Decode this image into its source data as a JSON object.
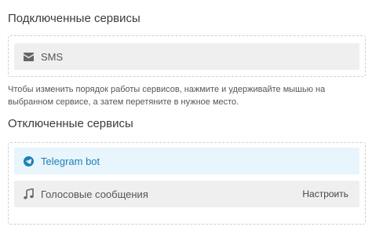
{
  "connected": {
    "title": "Подключенные сервисы",
    "items": [
      {
        "label": "SMS",
        "icon": "envelope-icon"
      }
    ]
  },
  "hint": "Чтобы изменить порядок работы сервисов, нажмите и удерживайте мышью на выбранном сервисе, а затем перетяните в нужное место.",
  "disconnected": {
    "title": "Отключенные сервисы",
    "items": [
      {
        "label": "Telegram bot",
        "icon": "telegram-icon"
      },
      {
        "label": "Голосовые сообщения",
        "icon": "music-note-icon",
        "action": "Настроить"
      }
    ]
  },
  "colors": {
    "telegram_accent": "#1d7fb9",
    "telegram_background": "#e8f5fc",
    "item_background": "#efefef",
    "border": "#cfcfcf"
  }
}
